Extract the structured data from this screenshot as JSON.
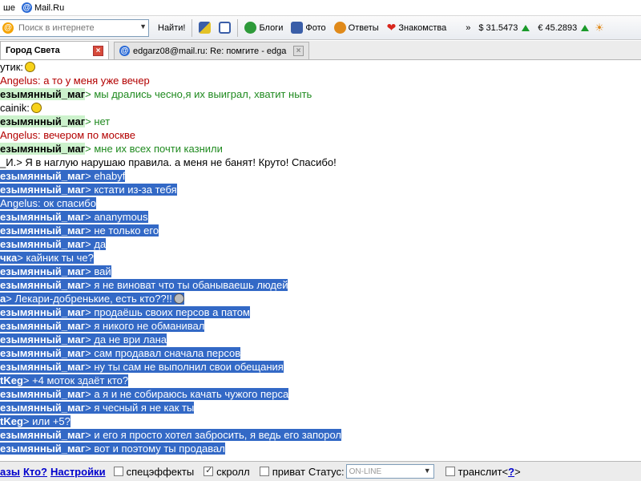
{
  "topbar": {
    "left_fragment": "ше",
    "mail_link": "Mail.Ru"
  },
  "toolbar": {
    "search_placeholder": "Поиск в интернете",
    "find_button": "Найти!",
    "blogs": "Блоги",
    "photo": "Фото",
    "answers": "Ответы",
    "dating": "Знакомства",
    "more": "»",
    "usd": "$ 31.5473",
    "eur": "€ 45.2893",
    "colors": {
      "blogs": "#2e9a3a",
      "photo": "#3a5ea8",
      "answers": "#e08a1a",
      "dating": "#d8261c",
      "up": "#1a9a2a"
    }
  },
  "tabs": [
    {
      "label": "Город Света",
      "active": true
    },
    {
      "label": "edgarz08@mail.ru: Re: помгите - edga...",
      "active": false
    }
  ],
  "chat": {
    "lines": [
      {
        "nick": "утик:",
        "text": "",
        "style": "plain",
        "smile": "yellow"
      },
      {
        "nick": "",
        "text": "Angelus: а то у меня уже вечер",
        "style": "red"
      },
      {
        "nick": "езымянный_маг",
        "text": "> мы дрались чесно,я их выиграл, хватит ныть",
        "style": "green"
      },
      {
        "nick": "cainik:",
        "text": "",
        "style": "plain",
        "smile": "yellow"
      },
      {
        "nick": "езымянный_маг",
        "text": "> нет",
        "style": "green"
      },
      {
        "nick": "",
        "text": "Angelus: вечером по москве",
        "style": "red"
      },
      {
        "nick": "езымянный_маг",
        "text": "> мне их всех почти казнили",
        "style": "green"
      },
      {
        "nick": "_И.",
        "text": "> Я в наглую нарушаю правила. а меня не банят! Круто! Спасибо!",
        "style": "plain"
      },
      {
        "nick": "езымянный_маг",
        "text": "> ehabyf",
        "style": "sel"
      },
      {
        "nick": "езымянный_маг",
        "text": "> кстати из-за тебя",
        "style": "sel"
      },
      {
        "nick": "",
        "text": "Angelus: ок спасибо",
        "style": "sel"
      },
      {
        "nick": "езымянный_маг",
        "text": "> ananymous",
        "style": "sel"
      },
      {
        "nick": "езымянный_маг",
        "text": "> не только его",
        "style": "sel"
      },
      {
        "nick": "езымянный_маг",
        "text": "> да",
        "style": "sel"
      },
      {
        "nick": "чка",
        "text": "> кайник ты че?",
        "style": "sel"
      },
      {
        "nick": "езымянный_маг",
        "text": "> вай",
        "style": "sel"
      },
      {
        "nick": "езымянный_маг",
        "text": "> я не виноват что ты обанываешь людей",
        "style": "sel"
      },
      {
        "nick": "а",
        "text": "> Лекари-добренькие, есть кто??!!",
        "style": "sel",
        "smile": "grey"
      },
      {
        "nick": "езымянный_маг",
        "text": "> продаёшь своих персов а патом",
        "style": "sel"
      },
      {
        "nick": "езымянный_маг",
        "text": "> я никого не обманивал",
        "style": "sel"
      },
      {
        "nick": "езымянный_маг",
        "text": "> да не ври лана",
        "style": "sel"
      },
      {
        "nick": "езымянный_маг",
        "text": "> сам продавал сначала персов",
        "style": "sel"
      },
      {
        "nick": "езымянный_маг",
        "text": "> ну ты сам не выполнил свои обещания",
        "style": "sel"
      },
      {
        "nick": "tKeg",
        "text": "> +4 моток здаёт кто?",
        "style": "sel"
      },
      {
        "nick": "езымянный_маг",
        "text": "> а я и не собираюсь качать чужого перса",
        "style": "sel"
      },
      {
        "nick": "езымянный_маг",
        "text": "> я чесный я не как ты",
        "style": "sel"
      },
      {
        "nick": "tKeg",
        "text": "> или +5?",
        "style": "sel"
      },
      {
        "nick": "езымянный_маг",
        "text": "> и его я просто хотел забросить, я ведь его запорол",
        "style": "sel"
      },
      {
        "nick": "езымянный_маг",
        "text": "> вот и поэтому ты продавал",
        "style": "sel"
      }
    ]
  },
  "bottombar": {
    "link_bases": "азы",
    "link_who": "Кто?",
    "link_settings": "Настройки",
    "fx_label": "спецэффекты",
    "scroll_label": "скролл",
    "private_label": "приват",
    "status_label": "Статус:",
    "status_value": "ON-LINE",
    "translit_label": "транслит",
    "translit_help_open": "<",
    "translit_help": "?",
    "translit_help_close": ">"
  }
}
